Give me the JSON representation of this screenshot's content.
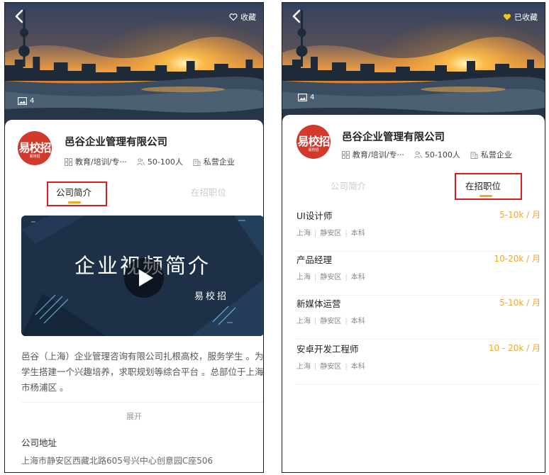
{
  "left": {
    "favorite_label": "收藏",
    "photo_count": "4",
    "company": {
      "logo_text": "易校招",
      "logo_sub": "易校招",
      "name": "邑谷企业管理有限公司",
      "industry": "教育/培训/专···",
      "size": "50-100人",
      "type": "私营企业"
    },
    "tabs": [
      "公司简介",
      "在招职位"
    ],
    "active_tab": 0,
    "video": {
      "title": "企业视频简介",
      "subtitle": "易校招"
    },
    "intro": "邑谷（上海）企业管理咨询有限公司扎根高校，服务学生 。为学生搭建一个兴趣培养，求职规划等综合平台 。总部位于上海市杨浦区 。",
    "expand_label": "展开",
    "address_title": "公司地址",
    "address": "上海市静安区西藏北路605号兴中心创意园C座506"
  },
  "right": {
    "favorite_label": "已收藏",
    "photo_count": "4",
    "company": {
      "logo_text": "易校招",
      "logo_sub": "易校招",
      "name": "邑谷企业管理有限公司",
      "industry": "教育/培训/专···",
      "size": "50-100人",
      "type": "私营企业"
    },
    "tabs": [
      "公司简介",
      "在招职位"
    ],
    "active_tab": 1,
    "jobs": [
      {
        "title": "UI设计师",
        "salary": "5-10k / 月",
        "city": "上海",
        "district": "静安区",
        "degree": "本科"
      },
      {
        "title": "产品经理",
        "salary": "10-20k / 月",
        "city": "上海",
        "district": "静安区",
        "degree": "本科"
      },
      {
        "title": "新媒体运营",
        "salary": "5-10k / 月",
        "city": "上海",
        "district": "静安区",
        "degree": "本科"
      },
      {
        "title": "安卓开发工程师",
        "salary": "10 - 20k / 月",
        "city": "上海",
        "district": "静安区",
        "degree": "本科"
      }
    ]
  },
  "colors": {
    "accent": "#f5a623",
    "highlight_box": "#e01b1b",
    "logo_red": "#d23a2c",
    "heart_filled": "#f5c518"
  }
}
